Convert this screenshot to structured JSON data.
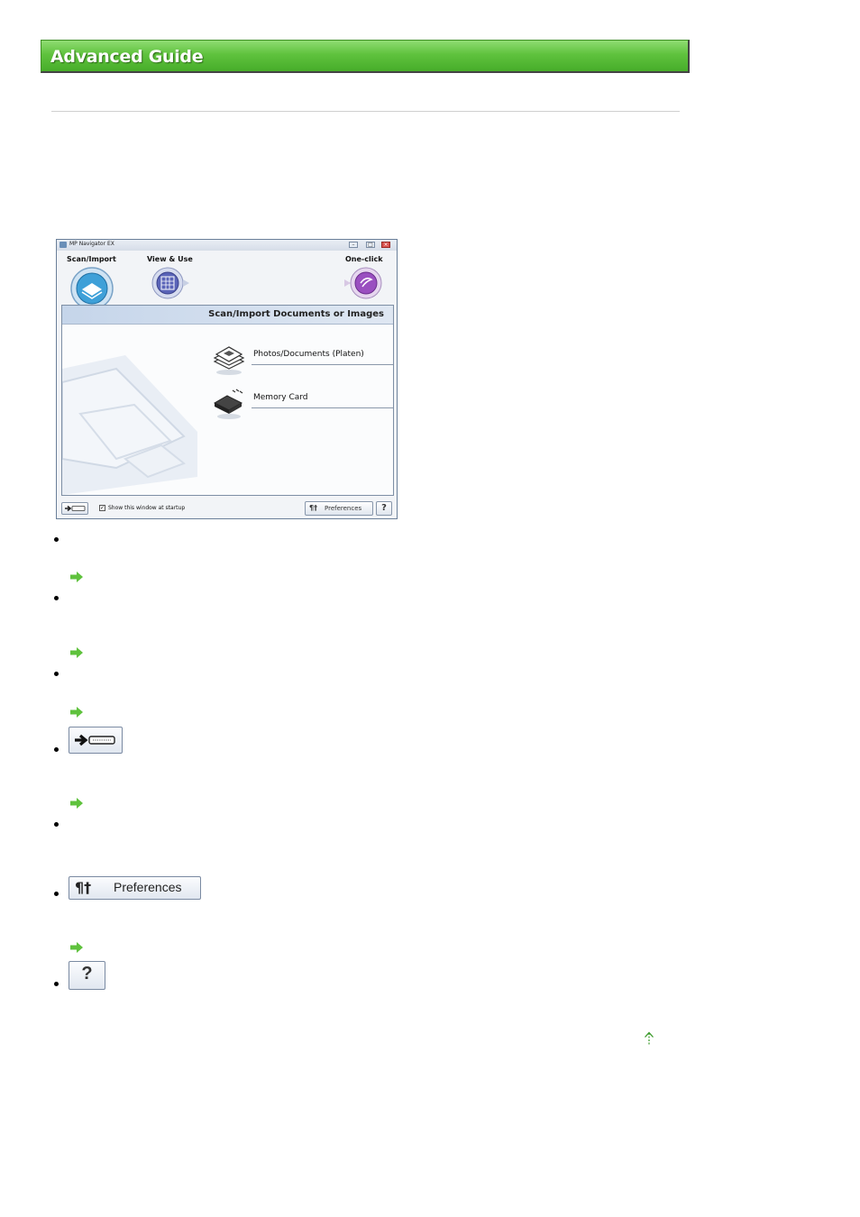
{
  "header": {
    "title": "Advanced Guide"
  },
  "screenshot": {
    "window_title": "MP Navigator EX",
    "modes": [
      {
        "label": "Scan/Import"
      },
      {
        "label": "View & Use"
      },
      {
        "label": "One-click"
      }
    ],
    "panel_title": "Scan/Import Documents or Images",
    "options": [
      {
        "label": "Photos/Documents (Platen)"
      },
      {
        "label": "Memory Card"
      }
    ],
    "checkbox_label": "Show this window at startup",
    "preferences_label": "Preferences",
    "help_label": "?"
  },
  "buttons": {
    "preferences_label": "Preferences",
    "help_label": "?"
  },
  "colors": {
    "banner_green": "#5fc23d",
    "link_arrow": "#5fc23d"
  }
}
